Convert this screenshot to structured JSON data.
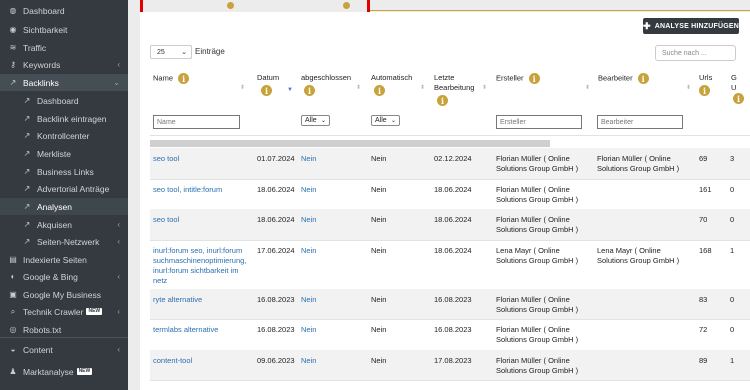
{
  "sidebar": {
    "items": [
      {
        "label": "Dashboard",
        "icon": "dashboard-icon",
        "glyph": "◍",
        "level": 0
      },
      {
        "label": "Sichtbarkeit",
        "icon": "eye-icon",
        "glyph": "◉",
        "level": 0
      },
      {
        "label": "Traffic",
        "icon": "wifi-icon",
        "glyph": "≋",
        "level": 0
      },
      {
        "label": "Keywords",
        "icon": "key-icon",
        "glyph": "⚷",
        "level": 0
      },
      {
        "label": "Backlinks",
        "icon": "external-link-icon",
        "glyph": "↗",
        "level": 0
      },
      {
        "label": "Dashboard",
        "icon": "external-link-icon",
        "glyph": "↗",
        "level": 1
      },
      {
        "label": "Backlink eintragen",
        "icon": "external-link-icon",
        "glyph": "↗",
        "level": 1
      },
      {
        "label": "Kontrollcenter",
        "icon": "external-link-icon",
        "glyph": "↗",
        "level": 1
      },
      {
        "label": "Merkliste",
        "icon": "external-link-icon",
        "glyph": "↗",
        "level": 1
      },
      {
        "label": "Business Links",
        "icon": "external-link-icon",
        "glyph": "↗",
        "level": 1
      },
      {
        "label": "Advertorial Anträge",
        "icon": "external-link-icon",
        "glyph": "↗",
        "level": 1
      },
      {
        "label": "Analysen",
        "icon": "external-link-icon",
        "glyph": "↗",
        "level": 1
      },
      {
        "label": "Akquisen",
        "icon": "external-link-icon",
        "glyph": "↗",
        "level": 1
      },
      {
        "label": "Seiten-Netzwerk",
        "icon": "external-link-icon",
        "glyph": "↗",
        "level": 1
      },
      {
        "label": "Indexierte Seiten",
        "icon": "list-icon",
        "glyph": "▤",
        "level": 0
      },
      {
        "label": "Google & Bing",
        "icon": "google-icon",
        "glyph": "◐",
        "level": 0
      },
      {
        "label": "Google My Business",
        "icon": "store-icon",
        "glyph": "▣",
        "level": 0
      },
      {
        "label": "Technik Crawler",
        "icon": "search-icon",
        "glyph": "⌕",
        "level": 0
      },
      {
        "label": "Robots.txt",
        "icon": "robot-icon",
        "glyph": "◎",
        "level": 0
      },
      {
        "label": "Content",
        "icon": "content-icon",
        "glyph": "◒",
        "level": 0
      },
      {
        "label": "Marktanalyse",
        "icon": "market-icon",
        "glyph": "♟",
        "level": 0
      }
    ],
    "new_badge": "NEW"
  },
  "toolbar": {
    "add_label": "ANALYSE HINZUFÜGEN",
    "page_length": "25",
    "page_length_label": "Einträge",
    "search_placeholder": "Suche nach ..."
  },
  "table": {
    "info_glyph": "i",
    "headers": {
      "name": "Name",
      "datum": "Datum",
      "abgeschlossen": "abgeschlossen",
      "automatisch": "Automatisch",
      "letzte1": "Letzte",
      "letzte2": "Bearbeitung",
      "ersteller": "Ersteller",
      "bearbeiter": "Bearbeiter",
      "urls": "Urls",
      "g1": "G",
      "g2": "U"
    },
    "filters": {
      "name": "Name",
      "abgeschlossen": "Alle",
      "automatisch": "Alle",
      "ersteller": "Ersteller",
      "bearbeiter": "Bearbeiter"
    },
    "rows": [
      {
        "name": [
          "seo tool"
        ],
        "datum": "01.07.2024",
        "abg": "Nein",
        "auto": "Nein",
        "letzte": "02.12.2024",
        "ersteller": [
          "Florian Müller ( Online",
          "Solutions Group GmbH )"
        ],
        "bearbeiter": [
          "Florian Müller ( Online",
          "Solutions Group GmbH )"
        ],
        "urls": "69",
        "g": "3"
      },
      {
        "name": [
          "seo tool, intitle:forum"
        ],
        "datum": "18.06.2024",
        "abg": "Nein",
        "auto": "Nein",
        "letzte": "18.06.2024",
        "ersteller": [
          "Florian Müller ( Online",
          "Solutions Group GmbH )"
        ],
        "bearbeiter": [],
        "urls": "161",
        "g": "0"
      },
      {
        "name": [
          "seo tool"
        ],
        "datum": "18.06.2024",
        "abg": "Nein",
        "auto": "Nein",
        "letzte": "18.06.2024",
        "ersteller": [
          "Florian Müller ( Online",
          "Solutions Group GmbH )"
        ],
        "bearbeiter": [],
        "urls": "70",
        "g": "0"
      },
      {
        "name": [
          "inurl:forum seo, inurl:forum",
          "suchmaschinenoptimierung,",
          "inurl:forum sichtbarkeit im",
          "netz"
        ],
        "datum": "17.06.2024",
        "abg": "Nein",
        "auto": "Nein",
        "letzte": "18.06.2024",
        "ersteller": [
          "Lena Mayr ( Online",
          "Solutions Group GmbH )"
        ],
        "bearbeiter": [
          "Lena Mayr ( Online",
          "Solutions Group GmbH )"
        ],
        "urls": "168",
        "g": "1"
      },
      {
        "name": [
          "ryte alternative"
        ],
        "datum": "16.08.2023",
        "abg": "Nein",
        "auto": "Nein",
        "letzte": "16.08.2023",
        "ersteller": [
          "Florian Müller ( Online",
          "Solutions Group GmbH )"
        ],
        "bearbeiter": [],
        "urls": "83",
        "g": "0"
      },
      {
        "name": [
          "termlabs alternative"
        ],
        "datum": "16.08.2023",
        "abg": "Nein",
        "auto": "Nein",
        "letzte": "16.08.2023",
        "ersteller": [
          "Florian Müller ( Online",
          "Solutions Group GmbH )"
        ],
        "bearbeiter": [],
        "urls": "72",
        "g": "0"
      },
      {
        "name": [
          "content-tool"
        ],
        "datum": "09.06.2023",
        "abg": "Nein",
        "auto": "Nein",
        "letzte": "17.08.2023",
        "ersteller": [
          "Florian Müller ( Online",
          "Solutions Group GmbH )"
        ],
        "bearbeiter": [],
        "urls": "89",
        "g": "1"
      }
    ]
  }
}
